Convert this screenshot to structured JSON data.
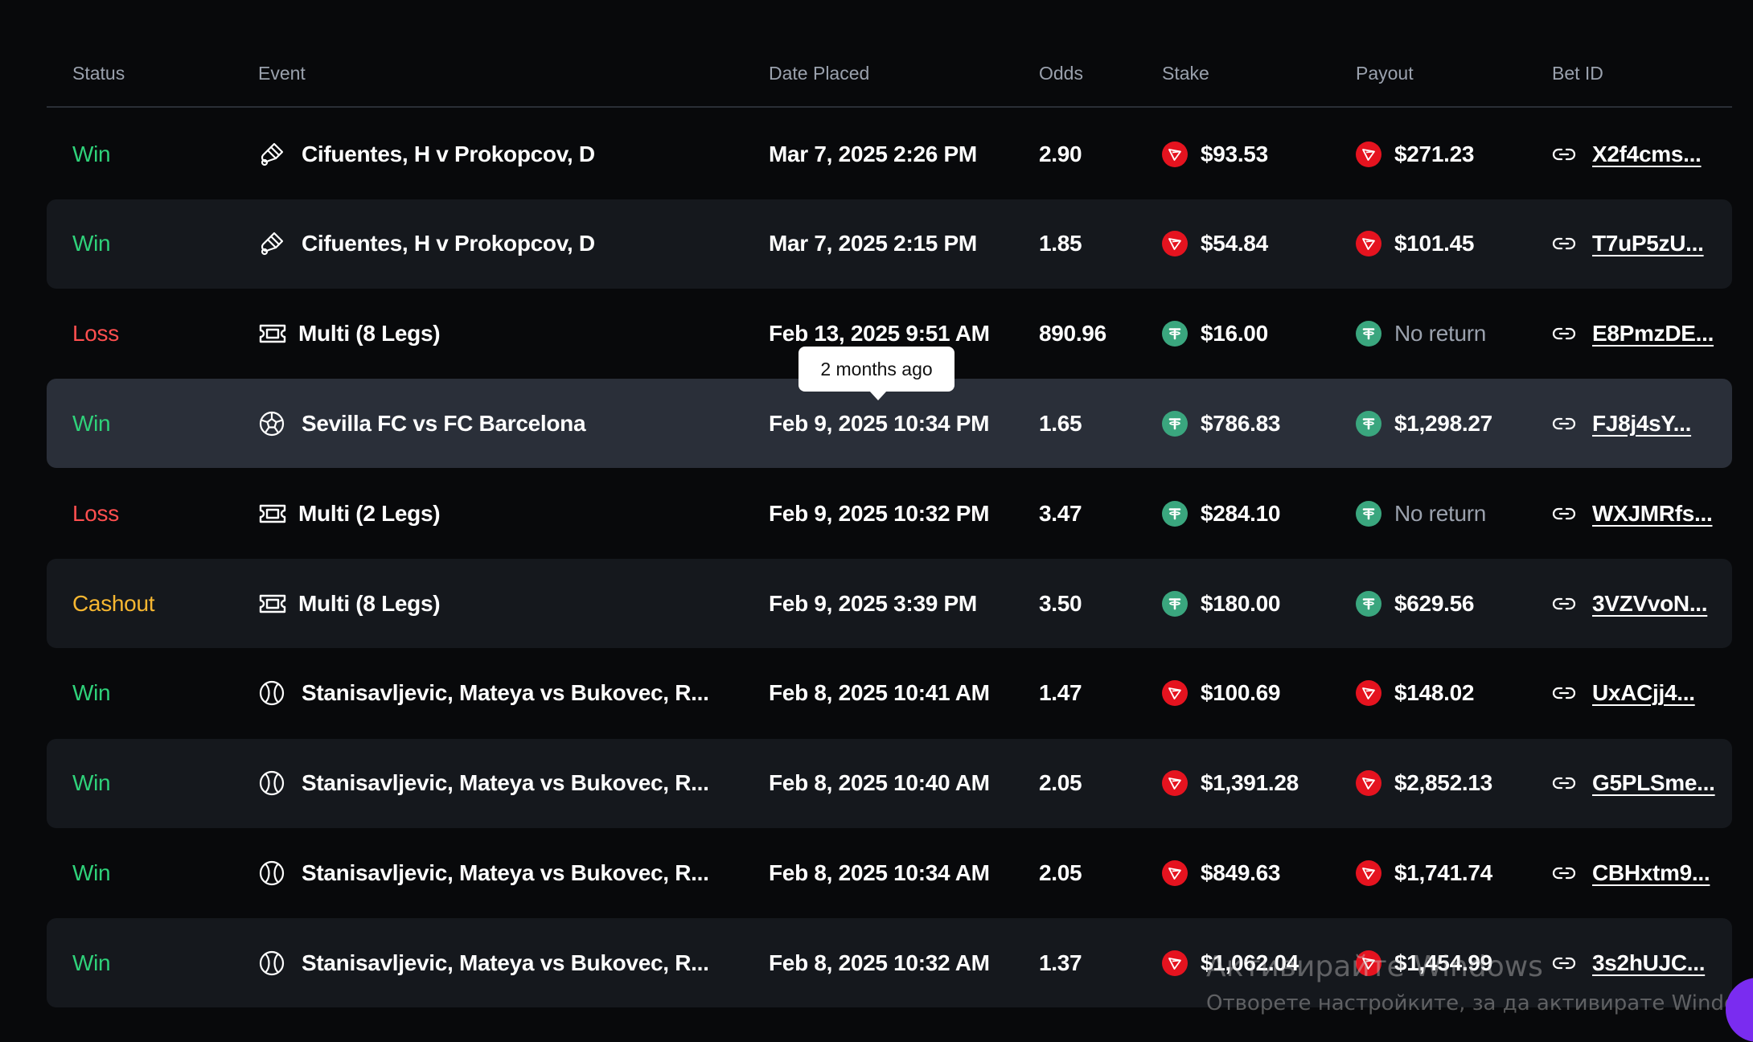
{
  "columns": {
    "status": "Status",
    "event": "Event",
    "date": "Date Placed",
    "odds": "Odds",
    "stake": "Stake",
    "payout": "Payout",
    "bet_id": "Bet ID"
  },
  "rows": [
    {
      "status": "Win",
      "status_type": "win",
      "sport_icon": "badminton-icon",
      "event": "Cifuentes, H v Prokopcov, D",
      "date": "Mar 7, 2025 2:26 PM",
      "odds": "2.90",
      "currency": "trx",
      "stake": "$93.53",
      "payout": "$271.23",
      "bet_id": "X2f4cms..."
    },
    {
      "status": "Win",
      "status_type": "win",
      "sport_icon": "badminton-icon",
      "event": "Cifuentes, H v Prokopcov, D",
      "date": "Mar 7, 2025 2:15 PM",
      "odds": "1.85",
      "currency": "trx",
      "stake": "$54.84",
      "payout": "$101.45",
      "bet_id": "T7uP5zU..."
    },
    {
      "status": "Loss",
      "status_type": "loss",
      "sport_icon": "multi-ticket-icon",
      "event": "Multi (8 Legs)",
      "date": "Feb 13, 2025 9:51 AM",
      "odds": "890.96",
      "currency": "usdt",
      "stake": "$16.00",
      "payout": "No return",
      "bet_id": "E8PmzDE..."
    },
    {
      "status": "Win",
      "status_type": "win",
      "sport_icon": "soccer-ball-icon",
      "event": "Sevilla FC vs FC Barcelona",
      "date": "Feb 9, 2025 10:34 PM",
      "odds": "1.65",
      "currency": "usdt",
      "stake": "$786.83",
      "payout": "$1,298.27",
      "bet_id": "FJ8j4sY..."
    },
    {
      "status": "Loss",
      "status_type": "loss",
      "sport_icon": "multi-ticket-icon",
      "event": "Multi (2 Legs)",
      "date": "Feb 9, 2025 10:32 PM",
      "odds": "3.47",
      "currency": "usdt",
      "stake": "$284.10",
      "payout": "No return",
      "bet_id": "WXJMRfs..."
    },
    {
      "status": "Cashout",
      "status_type": "cashout",
      "sport_icon": "multi-ticket-icon",
      "event": "Multi (8 Legs)",
      "date": "Feb 9, 2025 3:39 PM",
      "odds": "3.50",
      "currency": "usdt",
      "stake": "$180.00",
      "payout": "$629.56",
      "bet_id": "3VZVvoN..."
    },
    {
      "status": "Win",
      "status_type": "win",
      "sport_icon": "tennis-ball-icon",
      "event": "Stanisavljevic, Mateya vs Bukovec, R...",
      "date": "Feb 8, 2025 10:41 AM",
      "odds": "1.47",
      "currency": "trx",
      "stake": "$100.69",
      "payout": "$148.02",
      "bet_id": "UxACjj4..."
    },
    {
      "status": "Win",
      "status_type": "win",
      "sport_icon": "tennis-ball-icon",
      "event": "Stanisavljevic, Mateya vs Bukovec, R...",
      "date": "Feb 8, 2025 10:40 AM",
      "odds": "2.05",
      "currency": "trx",
      "stake": "$1,391.28",
      "payout": "$2,852.13",
      "bet_id": "G5PLSme..."
    },
    {
      "status": "Win",
      "status_type": "win",
      "sport_icon": "tennis-ball-icon",
      "event": "Stanisavljevic, Mateya vs Bukovec, R...",
      "date": "Feb 8, 2025 10:34 AM",
      "odds": "2.05",
      "currency": "trx",
      "stake": "$849.63",
      "payout": "$1,741.74",
      "bet_id": "CBHxtm9..."
    },
    {
      "status": "Win",
      "status_type": "win",
      "sport_icon": "tennis-ball-icon",
      "event": "Stanisavljevic, Mateya vs Bukovec, R...",
      "date": "Feb 8, 2025 10:32 AM",
      "odds": "1.37",
      "currency": "trx",
      "stake": "$1,062.04",
      "payout": "$1,454.99",
      "bet_id": "3s2hUJC..."
    }
  ],
  "tooltip": {
    "text": "2 months ago"
  },
  "watermark": {
    "title": "Активирайте Windows",
    "subtitle": "Отворете настройките, за да активирате Windows."
  },
  "colors": {
    "win": "#2fd27a",
    "loss": "#ff4f4f",
    "cashout": "#f7b731",
    "trx": "#e5131f",
    "usdt": "#3aa67e"
  }
}
